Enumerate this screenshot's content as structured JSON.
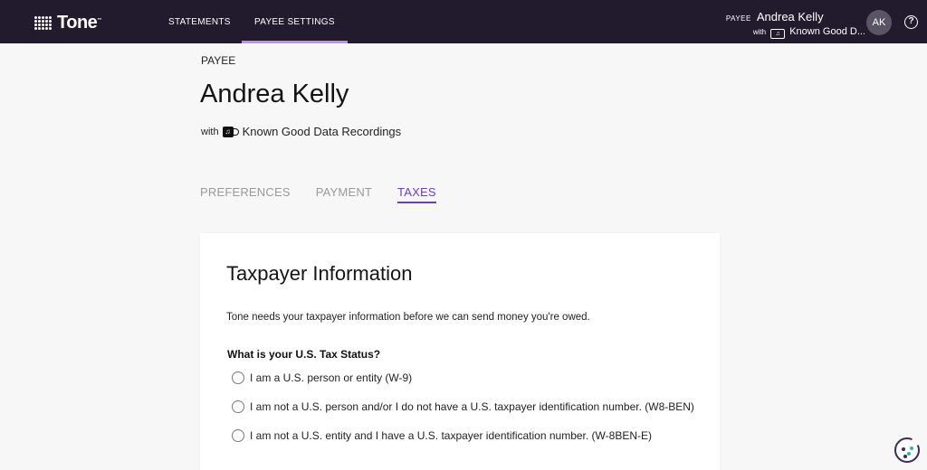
{
  "nav": {
    "logo": "Tone",
    "logo_tm": "™",
    "statements": "STATEMENTS",
    "payee_settings": "PAYEE SETTINGS"
  },
  "user": {
    "kicker": "PAYEE",
    "name": "Andrea Kelly",
    "with": "with",
    "label_truncated": "Known Good D...",
    "initials": "AK",
    "help": "?"
  },
  "header": {
    "kicker": "PAYEE",
    "name": "Andrea Kelly",
    "with": "with",
    "label": "Known Good Data Recordings"
  },
  "tabs": [
    {
      "label": "PREFERENCES",
      "active": false
    },
    {
      "label": "PAYMENT",
      "active": false
    },
    {
      "label": "TAXES",
      "active": true
    }
  ],
  "card": {
    "title": "Taxpayer Information",
    "description": "Tone needs your taxpayer information before we can send money you're owed.",
    "question": "What is your U.S. Tax Status?",
    "options": [
      "I am a U.S. person or entity (W-9)",
      "I am not a U.S. person and/or I do not have a U.S. taxpayer identification number. (W8-BEN)",
      "I am not a U.S. entity and I have a U.S. taxpayer identification number. (W-8BEN-E)"
    ]
  },
  "colors": {
    "nav_bg": "#221b2e",
    "accent": "#6b3fc4",
    "nav_underline": "#b892f0"
  }
}
